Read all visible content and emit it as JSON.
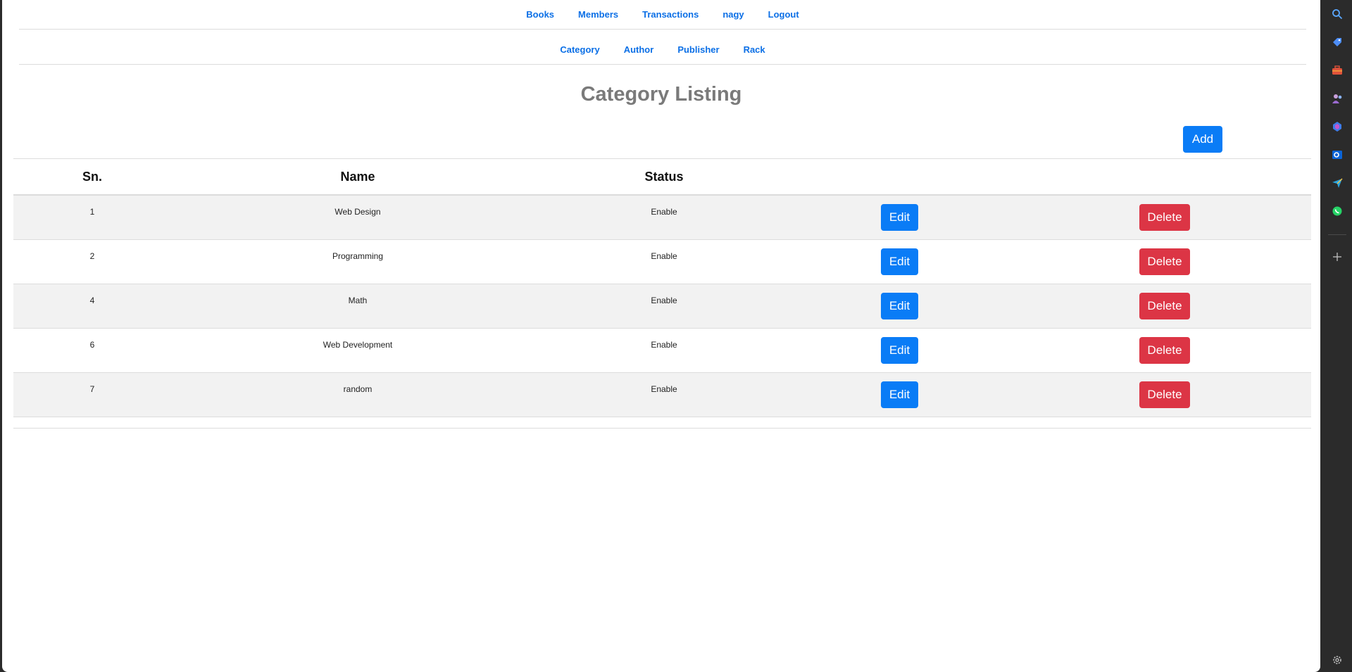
{
  "top_nav": [
    "Books",
    "Members",
    "Transactions",
    "nagy",
    "Logout"
  ],
  "sub_nav": [
    "Category",
    "Author",
    "Publisher",
    "Rack"
  ],
  "title": "Category Listing",
  "add_label": "Add",
  "table": {
    "headers": [
      "Sn.",
      "Name",
      "Status"
    ],
    "rows": [
      {
        "sn": "1",
        "name": "Web Design",
        "status": "Enable"
      },
      {
        "sn": "2",
        "name": "Programming",
        "status": "Enable"
      },
      {
        "sn": "4",
        "name": "Math",
        "status": "Enable"
      },
      {
        "sn": "6",
        "name": "Web Development",
        "status": "Enable"
      },
      {
        "sn": "7",
        "name": "random",
        "status": "Enable"
      }
    ],
    "edit_label": "Edit",
    "delete_label": "Delete"
  },
  "sidebar_icons": [
    "search-icon",
    "tag-icon",
    "toolbox-icon",
    "people-icon",
    "copilot-icon",
    "outlook-icon",
    "send-icon",
    "whatsapp-icon",
    "add-icon",
    "settings-icon"
  ],
  "colors": {
    "primary": "#0a7cf6",
    "danger": "#dc3545",
    "link": "#0b6fe6"
  }
}
